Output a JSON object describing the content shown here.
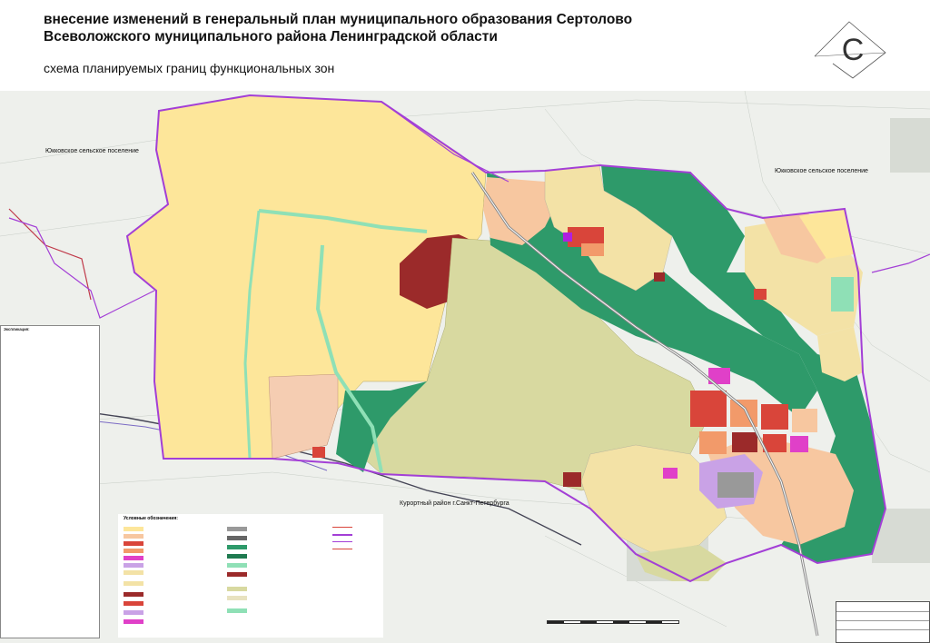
{
  "header": {
    "title_line1": "внесение изменений в генеральный план муниципального образования Сертолово",
    "title_line2": "Всеволожского муниципального района Ленинградской области",
    "subtitle": "схема планируемых границ функциональных зон"
  },
  "logo": {
    "letter": "С",
    "icon": "sertolovo-logo-icon"
  },
  "map_labels": {
    "west_settlement": "Юкковское сельское поселение",
    "east_settlement": "Юкковское сельское поселение",
    "south_district": "Курортный район г.Санкт-Петербурга"
  },
  "legend": {
    "title": "Экспликация:"
  },
  "bottom_legend": {
    "title": "Условные обозначения:"
  },
  "colors": {
    "yellow_zone": "#fde69a",
    "olive_zone": "#d8d9a0",
    "green_zone": "#2e9a6a",
    "salmon_zone": "#f7c7a0",
    "residential": "#f3e2a6",
    "red_zone": "#d9453a",
    "darkred_zone": "#9b2a2a",
    "purple_zone": "#c9a2e6",
    "magenta_zone": "#e040c8",
    "boundary": "#a33fd6",
    "greenway": "#8fe0b6"
  }
}
